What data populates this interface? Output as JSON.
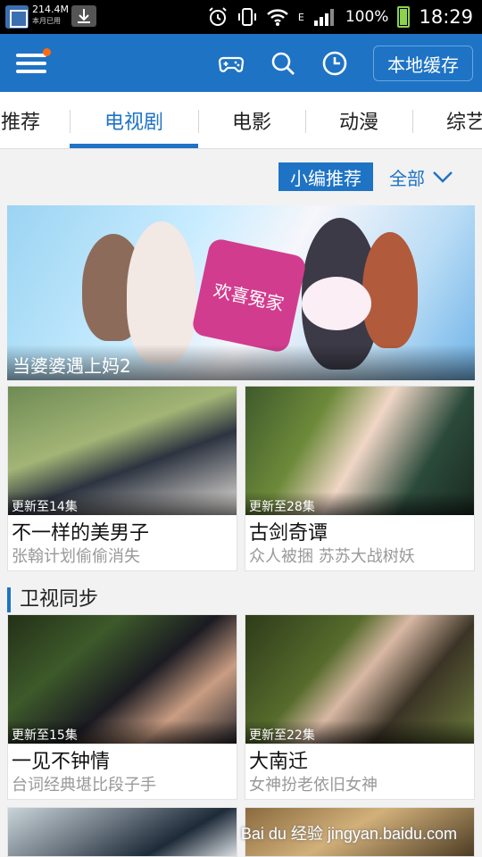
{
  "status_bar": {
    "data_usage": "214.4M",
    "data_sub": "本月已用",
    "network": "E",
    "battery": "100%",
    "time": "18:29"
  },
  "header": {
    "icons": [
      "menu-icon",
      "gamepad-icon",
      "search-icon",
      "history-clock-icon"
    ],
    "local_cache_label": "本地缓存",
    "accent_color": "#1e73c5"
  },
  "tabs": [
    {
      "label": "推荐"
    },
    {
      "label": "电视剧",
      "active": true
    },
    {
      "label": "电影"
    },
    {
      "label": "动漫"
    },
    {
      "label": "综艺"
    }
  ],
  "filter": {
    "recommend_tag": "小编推荐",
    "all_label": "全部"
  },
  "banner": {
    "title": "当婆婆遇上妈2",
    "poster_text": "欢喜冤家"
  },
  "recommended": [
    {
      "episodes": "更新至14集",
      "title": "不一样的美男子",
      "subtitle": "张翰计划偷偷消失"
    },
    {
      "episodes": "更新至28集",
      "title": "古剑奇谭",
      "subtitle": "众人被捆 苏苏大战树妖"
    }
  ],
  "section_satellite": {
    "title": "卫视同步",
    "items": [
      {
        "episodes": "更新至15集",
        "title": "一见不钟情",
        "subtitle": "台词经典堪比段子手"
      },
      {
        "episodes": "更新至22集",
        "title": "大南迁",
        "subtitle": "女神扮老依旧女神"
      }
    ]
  },
  "watermark": "Bai du 经验 jingyan.baidu.com"
}
